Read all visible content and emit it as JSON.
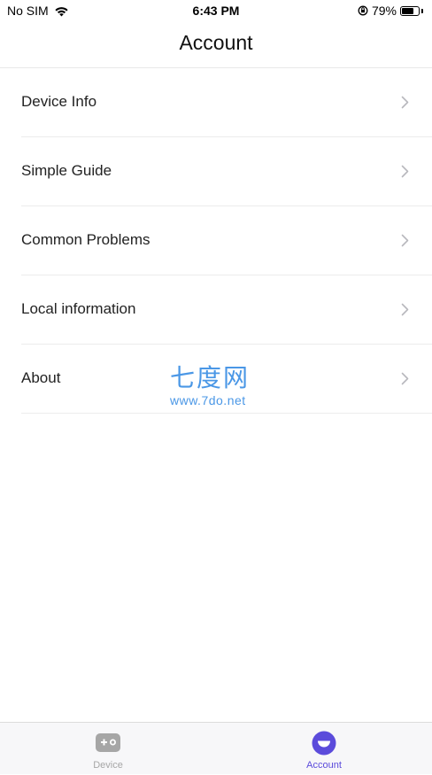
{
  "status_bar": {
    "carrier": "No SIM",
    "time": "6:43 PM",
    "battery_percent": "79%",
    "battery_level": 0.79,
    "icons": [
      "wifi-icon",
      "orientation-lock-icon",
      "battery-icon"
    ]
  },
  "header": {
    "title": "Account"
  },
  "menu": {
    "items": [
      {
        "label": "Device Info",
        "icon": "chevron-right-icon"
      },
      {
        "label": "Simple Guide",
        "icon": "chevron-right-icon"
      },
      {
        "label": "Common Problems",
        "icon": "chevron-right-icon"
      },
      {
        "label": "Local information",
        "icon": "chevron-right-icon"
      },
      {
        "label": "About",
        "icon": "chevron-right-icon"
      }
    ]
  },
  "watermark": {
    "text_cn": "七度网",
    "url": "www.7do.net"
  },
  "tab_bar": {
    "tabs": [
      {
        "label": "Device",
        "icon": "gamepad-icon",
        "active": false
      },
      {
        "label": "Account",
        "icon": "smiley-face-icon",
        "active": true
      }
    ]
  },
  "colors": {
    "accent": "#5b4bdb",
    "inactive": "#a6a6a6",
    "watermark": "#4a97e6",
    "divider": "#ececec"
  }
}
